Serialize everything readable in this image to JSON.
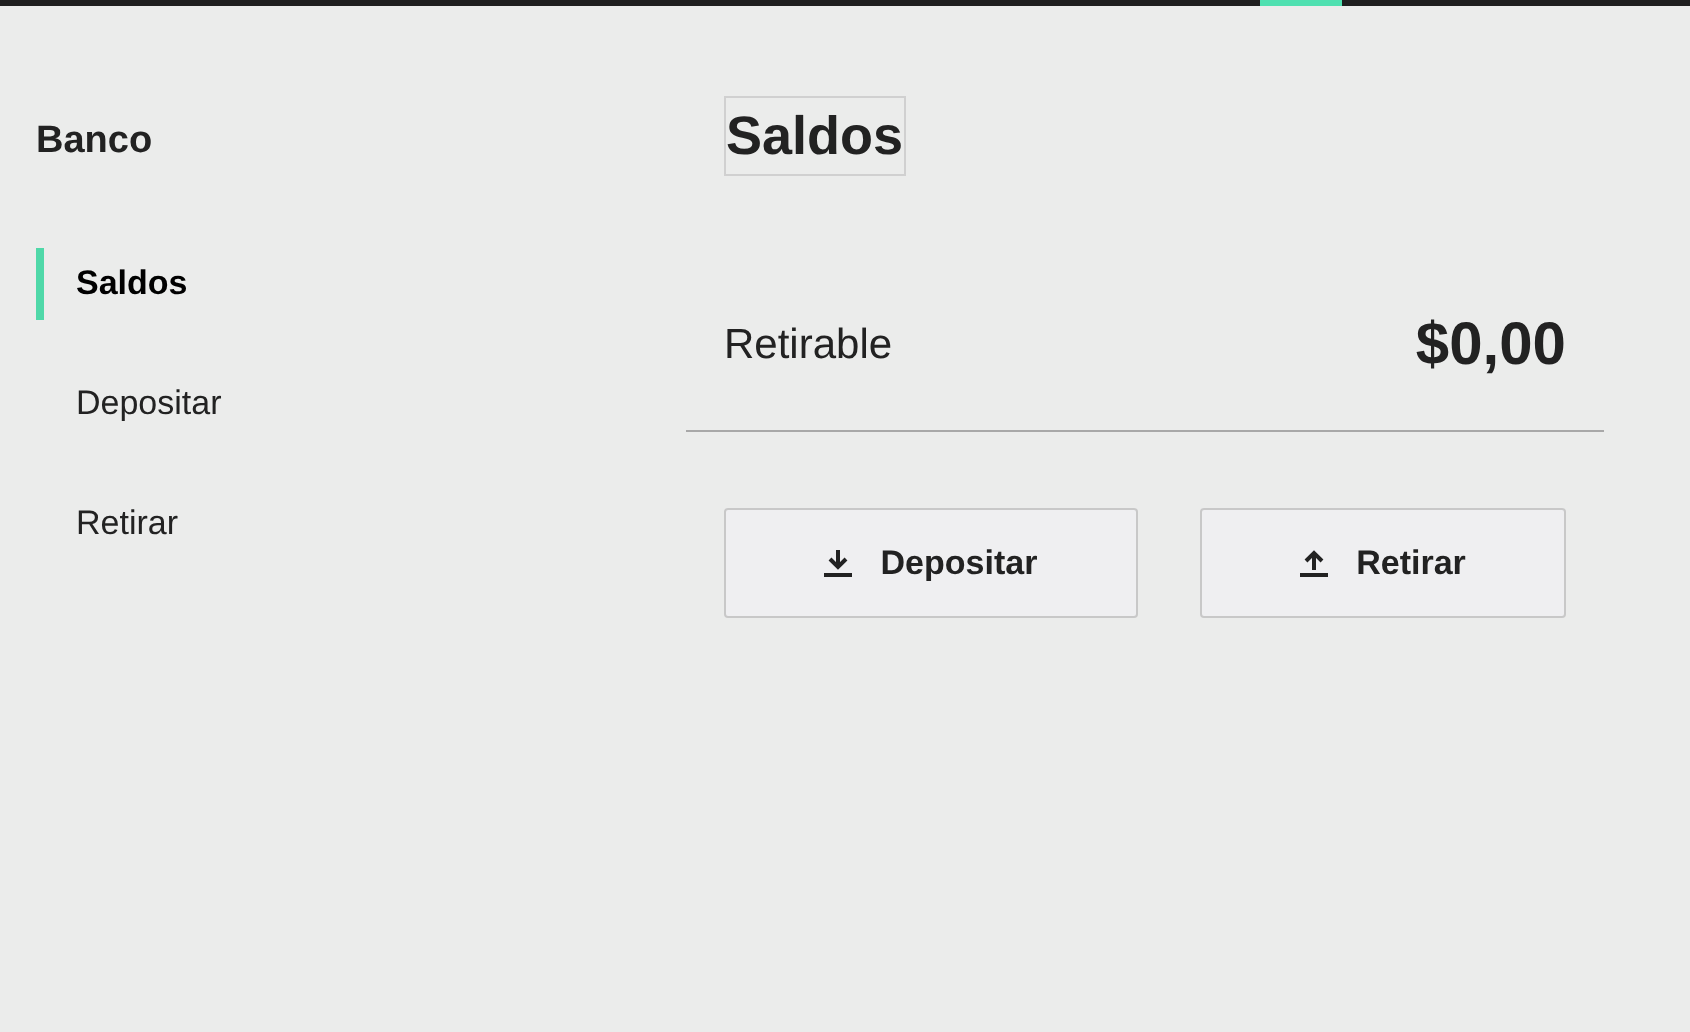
{
  "sidebar": {
    "title": "Banco",
    "items": [
      {
        "label": "Saldos",
        "selected": true
      },
      {
        "label": "Depositar",
        "selected": false
      },
      {
        "label": "Retirar",
        "selected": false
      }
    ]
  },
  "page": {
    "title": "Saldos",
    "balance": {
      "label": "Retirable",
      "value": "$0,00"
    },
    "buttons": [
      {
        "kind": "deposit",
        "label": "Depositar"
      },
      {
        "kind": "withdraw",
        "label": "Retirar"
      }
    ]
  }
}
